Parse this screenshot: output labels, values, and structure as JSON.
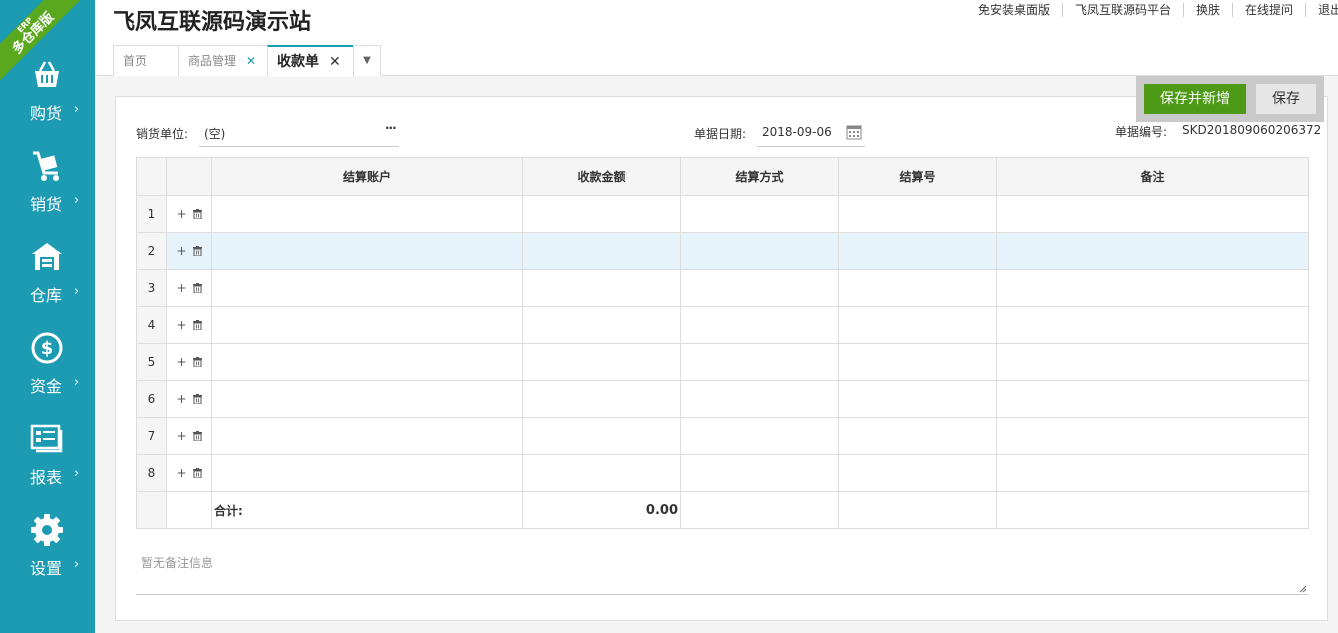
{
  "sidebar": {
    "badge_top": "ERP",
    "badge_main": "多仓库版",
    "items": [
      {
        "label": "购货",
        "icon": "basket-icon"
      },
      {
        "label": "销货",
        "icon": "cart-icon"
      },
      {
        "label": "仓库",
        "icon": "warehouse-icon"
      },
      {
        "label": "资金",
        "icon": "dollar-icon"
      },
      {
        "label": "报表",
        "icon": "report-icon"
      },
      {
        "label": "设置",
        "icon": "gear-icon"
      }
    ]
  },
  "header": {
    "title": "飞凤互联源码演示站",
    "links": [
      "免安装桌面版",
      "飞凤互联源码平台",
      "换肤",
      "在线提问",
      "退出"
    ]
  },
  "tabs": [
    {
      "label": "首页",
      "closable": false
    },
    {
      "label": "商品管理",
      "closable": true
    },
    {
      "label": "收款单",
      "closable": true,
      "active": true
    }
  ],
  "actions": {
    "save_new": "保存并新增",
    "save": "保存"
  },
  "form": {
    "customer_label": "销货单位:",
    "customer_value": "(空)",
    "date_label": "单据日期:",
    "date_value": "2018-09-06",
    "number_label": "单据编号:",
    "number_value": "SKD201809060206372"
  },
  "table": {
    "columns": [
      "结算账户",
      "收款金额",
      "结算方式",
      "结算号",
      "备注"
    ],
    "rows": [
      "1",
      "2",
      "3",
      "4",
      "5",
      "6",
      "7",
      "8"
    ],
    "highlighted_row": 2,
    "total_label": "合计:",
    "total_amount": "0.00"
  },
  "note": {
    "placeholder": "暂无备注信息"
  },
  "colors": {
    "sidebar": "#1d9bb3",
    "primary_button": "#4c9a16",
    "row_highlight": "#e6f3fa"
  }
}
